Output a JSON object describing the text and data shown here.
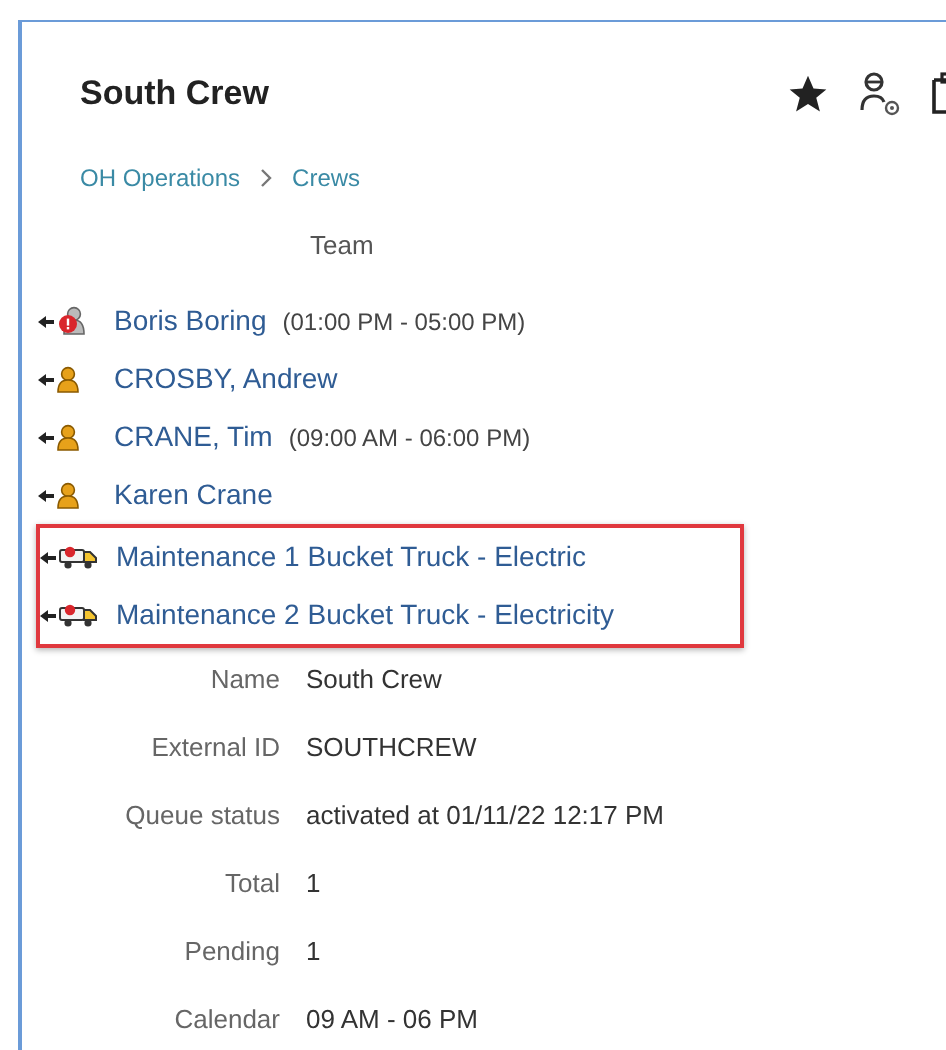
{
  "title": "South Crew",
  "breadcrumb": [
    "OH Operations",
    "Crews"
  ],
  "team_heading": "Team",
  "team": [
    {
      "kind": "alert-person",
      "name": "Boris Boring",
      "hours": "(01:00 PM - 05:00 PM)",
      "highlighted": false
    },
    {
      "kind": "person",
      "name": "CROSBY, Andrew",
      "highlighted": false
    },
    {
      "kind": "person",
      "name": "CRANE, Tim",
      "hours": "(09:00 AM - 06:00 PM)",
      "highlighted": false
    },
    {
      "kind": "person",
      "name": "Karen Crane",
      "highlighted": false
    },
    {
      "kind": "truck",
      "name": "Maintenance 1 Bucket Truck - Electric",
      "highlighted": true
    },
    {
      "kind": "truck",
      "name": "Maintenance 2 Bucket Truck - Electricity",
      "highlighted": true
    }
  ],
  "details": [
    {
      "label": "Name",
      "value": "South Crew"
    },
    {
      "label": "External ID",
      "value": "SOUTHCREW"
    },
    {
      "label": "Queue status",
      "value": "activated at 01/11/22 12:17 PM"
    },
    {
      "label": "Total",
      "value": "1"
    },
    {
      "label": "Pending",
      "value": "1"
    },
    {
      "label": "Calendar",
      "value": "09 AM - 06 PM"
    }
  ]
}
